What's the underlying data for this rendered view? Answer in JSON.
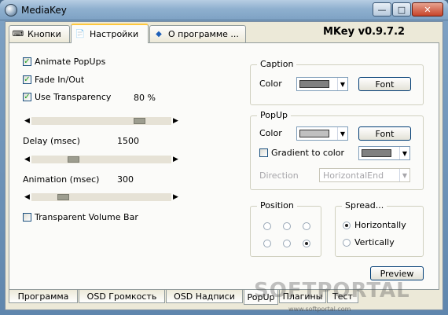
{
  "window": {
    "title": "MediaKey"
  },
  "top_tabs": [
    {
      "label": "Кнопки",
      "icon": "keyboard-icon"
    },
    {
      "label": "Настройки",
      "icon": "settings-icon"
    },
    {
      "label": "О программе ...",
      "icon": "info-icon"
    }
  ],
  "version": "MKey v0.9.7.2",
  "settings": {
    "animate_popups": {
      "label": "Animate PopUps",
      "checked": true
    },
    "fade_inout": {
      "label": "Fade In/Out",
      "checked": true
    },
    "use_transparency": {
      "label": "Use Transparency",
      "checked": true,
      "value": "80",
      "unit": "%"
    },
    "delay": {
      "label": "Delay (msec)",
      "value": "1500"
    },
    "animation": {
      "label": "Animation (msec)",
      "value": "300"
    },
    "transparent_volume_bar": {
      "label": "Transparent Volume Bar",
      "checked": false
    },
    "sliders": {
      "transparency_level": 0.8,
      "delay_level": 0.28,
      "animation_level": 0.2
    }
  },
  "caption_group": {
    "title": "Caption",
    "color_label": "Color",
    "color_value": "#808080",
    "font_button": "Font"
  },
  "popup_group": {
    "title": "PopUp",
    "color_label": "Color",
    "color_value": "#c0c0c0",
    "font_button": "Font",
    "gradient_label": "Gradient to color",
    "gradient_checked": false,
    "gradient_color": "#808080",
    "direction_label": "Direction",
    "direction_value": "HorizontalEnd"
  },
  "position_group": {
    "title": "Position",
    "selected_index": 5
  },
  "spread_group": {
    "title": "Spread...",
    "options": [
      "Horizontally",
      "Vertically"
    ],
    "selected": "Horizontally"
  },
  "preview_button": "Preview",
  "bottom_tabs": [
    "Программа",
    "OSD Громкость",
    "OSD Надписи",
    "PopUp",
    "Плагины",
    "Тест"
  ],
  "bottom_tab_active": "PopUp",
  "watermark": {
    "text": "SOFTPORTAL",
    "url": "www.softportal.com"
  }
}
